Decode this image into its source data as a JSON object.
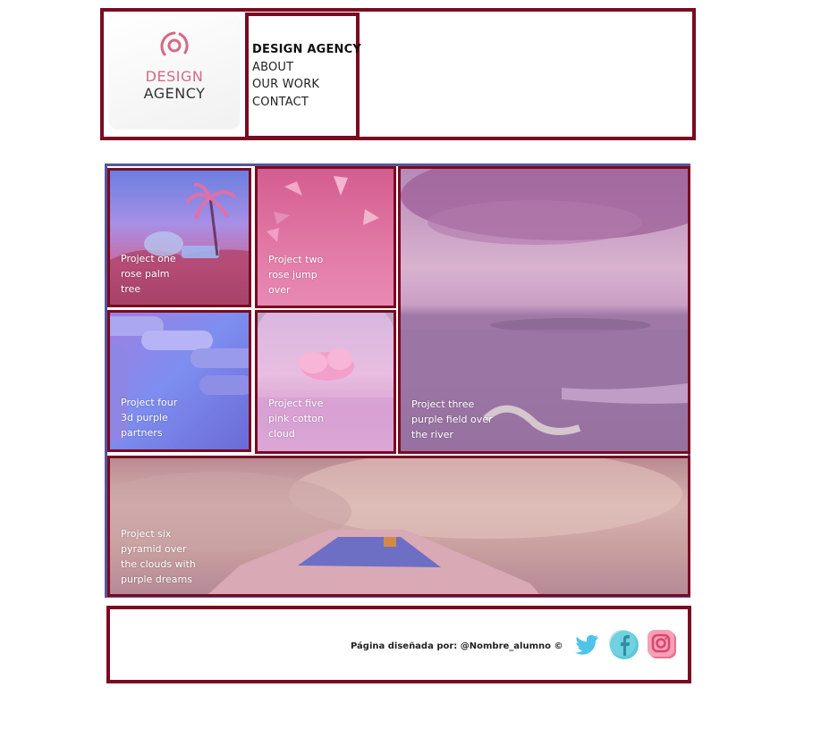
{
  "header": {
    "logo": {
      "line1": "DESIGN",
      "line2": "AGENCY",
      "accent": "#d46a85"
    },
    "nav": {
      "brand": "DESIGN AGENCY",
      "items": [
        "ABOUT",
        "OUR WORK",
        "CONTACT"
      ]
    }
  },
  "gallery": {
    "projects": [
      {
        "caption": [
          "Project one",
          "rose palm",
          "tree"
        ]
      },
      {
        "caption": [
          "Project two",
          "rose jump",
          "over"
        ]
      },
      {
        "caption": [
          "Project three",
          "purple field over",
          "the river"
        ]
      },
      {
        "caption": [
          "Project four",
          "3d purple",
          "partners"
        ]
      },
      {
        "caption": [
          "Project five",
          "pink cotton",
          "cloud"
        ]
      },
      {
        "caption": [
          "Project six",
          "pyramid over",
          "the clouds with",
          "purple dreams"
        ]
      }
    ]
  },
  "footer": {
    "credit": "Página diseñada por: @Nombre_alumno ©",
    "social": [
      {
        "icon": "twitter-icon",
        "color": "#4fc3e8"
      },
      {
        "icon": "facebook-icon",
        "color": "#5cc7d6"
      },
      {
        "icon": "instagram-icon",
        "color": "#e9708e"
      }
    ]
  },
  "colors": {
    "border": "#7a0a22",
    "gallery_border": "#55559c"
  }
}
